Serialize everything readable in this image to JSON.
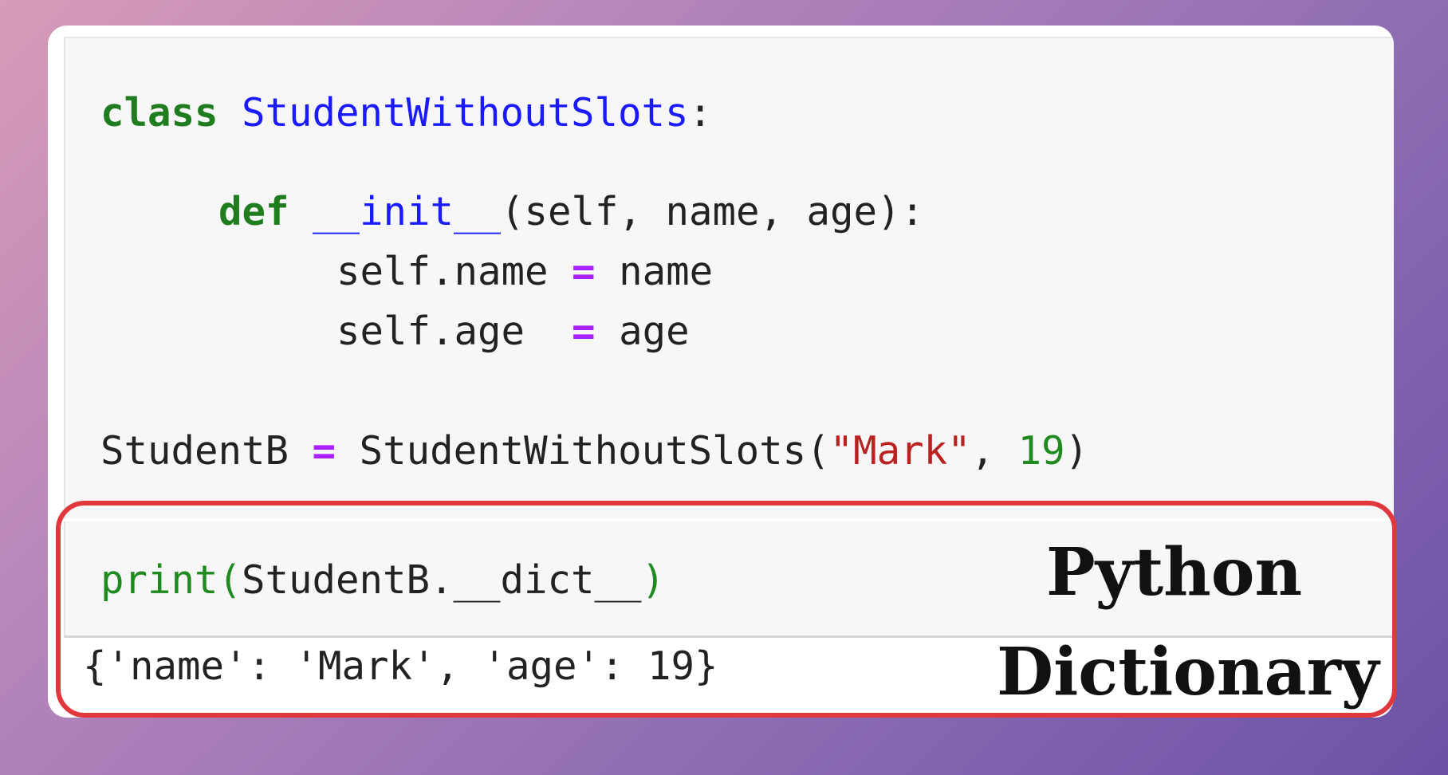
{
  "code": {
    "class_keyword": "class",
    "class_name": "StudentWithoutSlots",
    "colon": ":",
    "def_keyword": "def",
    "init_name": "__init__",
    "init_params": "(self, name, age):",
    "assign1_lhs": "self.name",
    "assign_op": "=",
    "assign1_rhs": "name",
    "assign2_lhs": "self.age",
    "assign2_rhs": "age",
    "instance_var": "StudentB",
    "constructor_call": "StudentWithoutSlots(",
    "arg_string": "\"Mark\"",
    "arg_sep": ", ",
    "arg_number": "19",
    "close_paren": ")"
  },
  "print_cell": {
    "print_fn": "print(",
    "print_arg": "StudentB.__dict__",
    "print_close": ")"
  },
  "output": {
    "text": "{'name': 'Mark', 'age': 19}"
  },
  "labels": {
    "python": "Python",
    "dictionary": "Dictionary"
  },
  "colors": {
    "keyword": "#1f7d1f",
    "class_name": "#1a1aff",
    "operator": "#aa22ff",
    "string": "#ba2121",
    "number": "#1f8a1f",
    "highlight_border": "#e0383d"
  }
}
